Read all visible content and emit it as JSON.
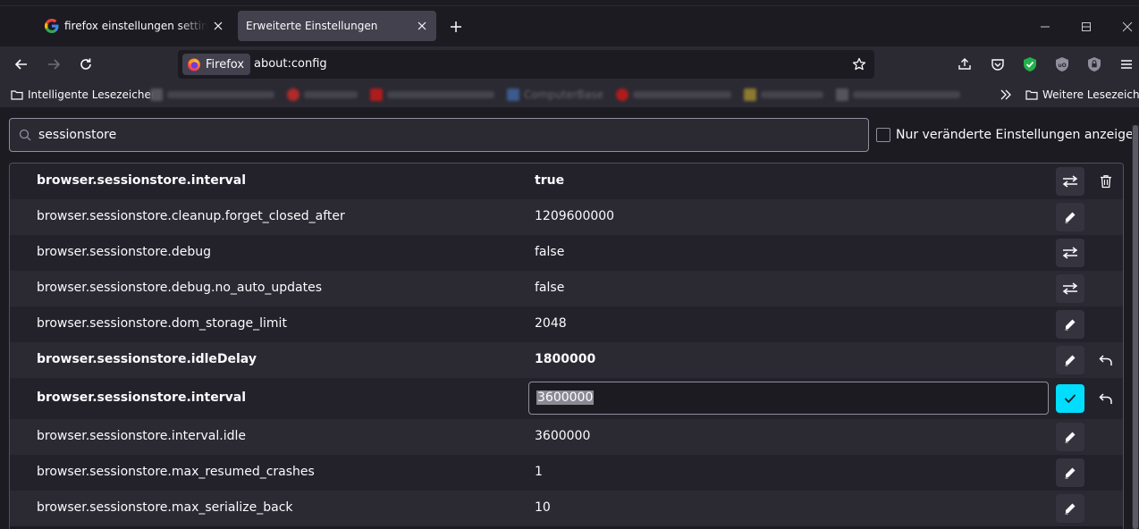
{
  "tabs": [
    {
      "label": "firefox einstellungen settings - Google Suche",
      "favicon": "google-icon"
    },
    {
      "label": "Erweiterte Einstellungen",
      "favicon": "none"
    }
  ],
  "navbar": {
    "identity_label": "Firefox",
    "url": "about:config"
  },
  "bookmarks": {
    "first_label": "Intelligente Lesezeichen",
    "visible_blurred": [
      "ComputerBase"
    ],
    "other_label": "Weitere Lesezeichen"
  },
  "search": {
    "value": "sessionstore"
  },
  "filter": {
    "label": "Nur veränderte Einstellungen anzeigen",
    "checked": false
  },
  "prefs": [
    {
      "name": "browser.sessionstore.interval",
      "value": "true",
      "modified": true,
      "type": "boolean",
      "actions": [
        "toggle-icon",
        "trash-icon"
      ]
    },
    {
      "name": "browser.sessionstore.cleanup.forget_closed_after",
      "value": "1209600000",
      "modified": false,
      "type": "number",
      "actions": [
        "pencil-icon"
      ]
    },
    {
      "name": "browser.sessionstore.debug",
      "value": "false",
      "modified": false,
      "type": "boolean",
      "actions": [
        "toggle-icon"
      ]
    },
    {
      "name": "browser.sessionstore.debug.no_auto_updates",
      "value": "false",
      "modified": false,
      "type": "boolean",
      "actions": [
        "toggle-icon"
      ]
    },
    {
      "name": "browser.sessionstore.dom_storage_limit",
      "value": "2048",
      "modified": false,
      "type": "number",
      "actions": [
        "pencil-icon"
      ]
    },
    {
      "name": "browser.sessionstore.idleDelay",
      "value": "1800000",
      "modified": true,
      "type": "number",
      "actions": [
        "pencil-icon",
        "reset-icon"
      ]
    },
    {
      "name": "browser.sessionstore.interval",
      "value": "3600000",
      "modified": true,
      "type": "number",
      "editing": true,
      "actions": [
        "checkmark-icon",
        "reset-icon"
      ]
    },
    {
      "name": "browser.sessionstore.interval.idle",
      "value": "3600000",
      "modified": false,
      "type": "number",
      "actions": [
        "pencil-icon"
      ]
    },
    {
      "name": "browser.sessionstore.max_resumed_crashes",
      "value": "1",
      "modified": false,
      "type": "number",
      "actions": [
        "pencil-icon"
      ]
    },
    {
      "name": "browser.sessionstore.max_serialize_back",
      "value": "10",
      "modified": false,
      "type": "number",
      "actions": [
        "pencil-icon"
      ]
    }
  ],
  "colors": {
    "accent": "#00ddff",
    "toolbar": "#2b2a33",
    "background": "#1c1b22",
    "extension_green": "#22b14c"
  }
}
